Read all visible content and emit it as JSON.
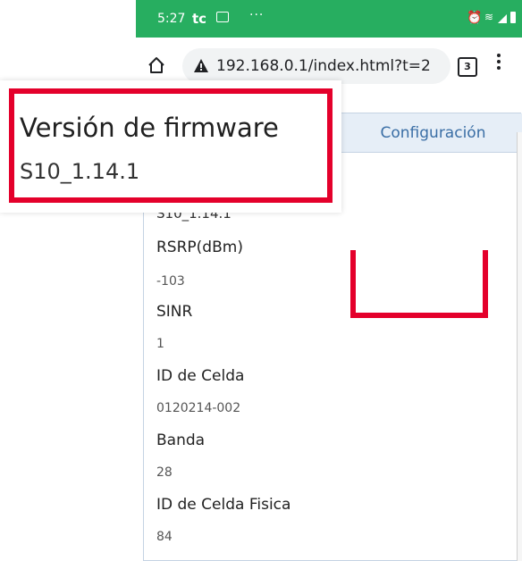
{
  "status_bar": {
    "time": "5:27",
    "carrier": "tc",
    "overflow": "···",
    "bg_color": "#27ae60",
    "icons": [
      "sim-icon",
      "alarm-icon",
      "wifi-icon",
      "signal-icon",
      "battery-icon"
    ]
  },
  "browser": {
    "url": "192.168.0.1/index.html?t=2",
    "tab_count": "3",
    "icons": [
      "home-icon",
      "warning-icon",
      "tabs-icon",
      "menu-icon"
    ]
  },
  "page": {
    "config_tab": "Configuración",
    "partial_value": "S10_1.14.1",
    "fields": [
      {
        "label": "RSRP(dBm)",
        "value": "-103"
      },
      {
        "label": "SINR",
        "value": "1"
      },
      {
        "label": "ID de Celda",
        "value": "0120214-002"
      },
      {
        "label": "Banda",
        "value": "28"
      },
      {
        "label": "ID de Celda Fisica",
        "value": "84"
      }
    ],
    "accent_color": "#3a6ea5",
    "highlight_color": "#e4002b"
  },
  "callout": {
    "title": "Versión de firmware",
    "value": "S10_1.14.1"
  }
}
